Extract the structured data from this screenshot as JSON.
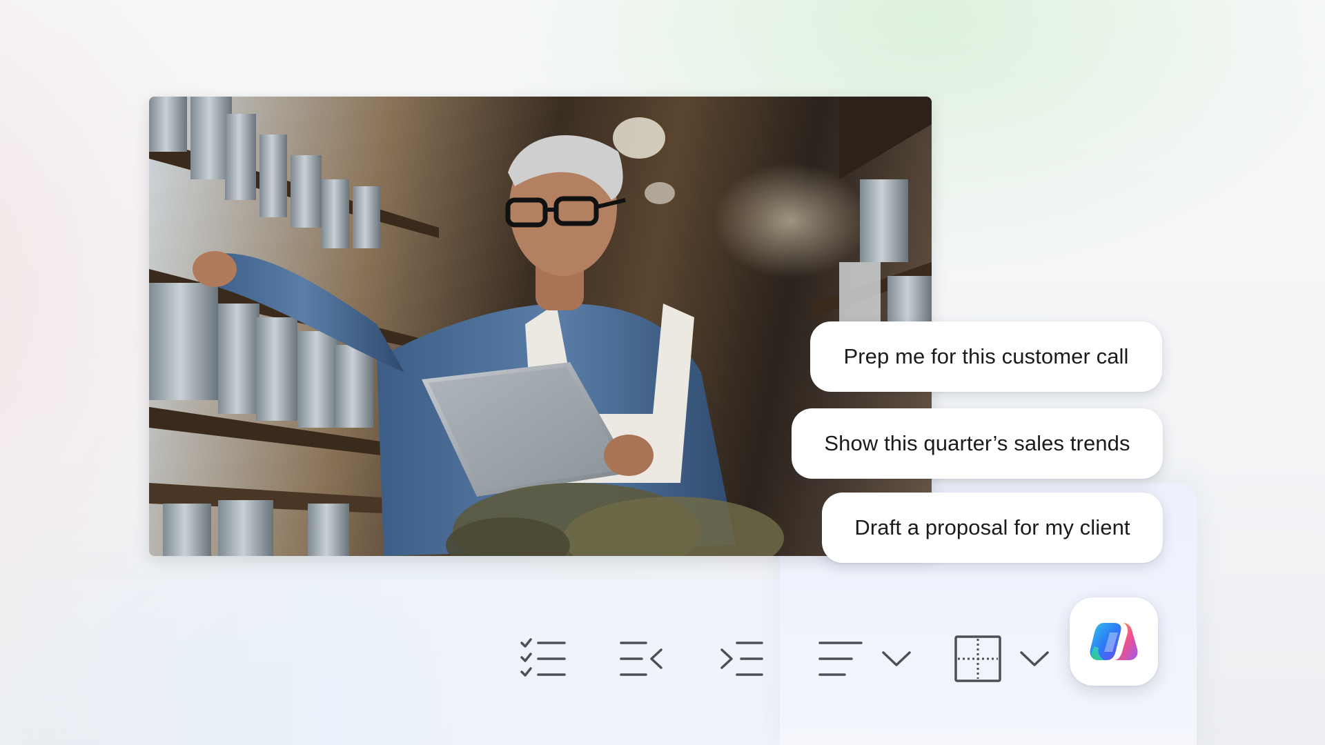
{
  "photo": {
    "subject": "shop-owner-with-clipboard-icon"
  },
  "suggestions": [
    {
      "label": "Prep me for this customer call"
    },
    {
      "label": "Show this quarter’s sales trends"
    },
    {
      "label": "Draft a proposal for my client"
    }
  ],
  "toolbar": {
    "icons": [
      "checklist-icon",
      "decrease-indent-icon",
      "increase-indent-icon",
      "align-icon",
      "chevron-down-icon",
      "table-borders-icon",
      "chevron-down-icon",
      "copilot-icon"
    ],
    "icon_color": "#4a4f5a"
  },
  "colors": {
    "copilot_gradient": [
      "#2b7bf5",
      "#35c6e8",
      "#9b5cf0",
      "#f0508a",
      "#ffb02e"
    ]
  }
}
